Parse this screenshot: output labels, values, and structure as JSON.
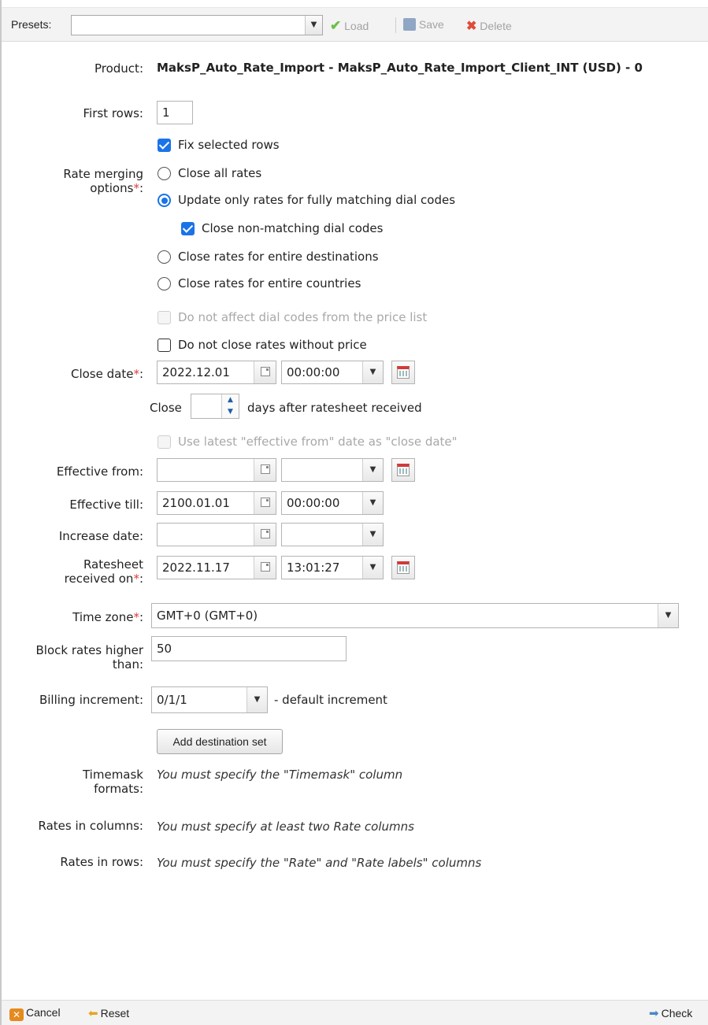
{
  "toolbar": {
    "presets_label": "Presets:",
    "presets_value": "",
    "load_label": "Load",
    "save_label": "Save",
    "delete_label": "Delete"
  },
  "form": {
    "product_label": "Product:",
    "product_value": "MaksP_Auto_Rate_Import - MaksP_Auto_Rate_Import_Client_INT (USD) - 0",
    "first_rows_label": "First rows:",
    "first_rows_value": "1",
    "fix_selected_rows": "Fix selected rows",
    "rate_merging_label_1": "Rate merging",
    "rate_merging_label_2": "options",
    "rate_merging_options": [
      "Close all rates",
      "Update only rates for fully matching dial codes",
      "Close rates for entire destinations",
      "Close rates for entire countries"
    ],
    "rate_merging_selected": 1,
    "close_non_matching": "Close non-matching dial codes",
    "do_not_affect": "Do not affect dial codes from the price list",
    "do_not_close": "Do not close rates without price",
    "close_date_label": "Close date",
    "close_date_value": "2022.12.01",
    "close_time_value": "00:00:00",
    "close_prefix": "Close",
    "close_days_value": "",
    "close_suffix": "days after ratesheet received",
    "use_latest": "Use latest \"effective from\" date as \"close date\"",
    "effective_from_label": "Effective from:",
    "effective_from_date": "",
    "effective_from_time": "",
    "effective_till_label": "Effective till:",
    "effective_till_date": "2100.01.01",
    "effective_till_time": "00:00:00",
    "increase_date_label": "Increase date:",
    "increase_date_date": "",
    "increase_date_time": "",
    "ratesheet_label_1": "Ratesheet",
    "ratesheet_label_2": "received on",
    "ratesheet_date": "2022.11.17",
    "ratesheet_time": "13:01:27",
    "time_zone_label": "Time zone",
    "time_zone_value": "GMT+0 (GMT+0)",
    "block_label_1": "Block rates higher",
    "block_label_2": "than:",
    "block_value": "50",
    "billing_label": "Billing increment:",
    "billing_value": "0/1/1",
    "billing_suffix": "- default increment",
    "add_destination_set": "Add destination set",
    "timemask_label_1": "Timemask",
    "timemask_label_2": "formats:",
    "timemask_hint": "You must specify the \"Timemask\" column",
    "rates_columns_label": "Rates in columns:",
    "rates_columns_hint": "You must specify at least two Rate columns",
    "rates_rows_label": "Rates in rows:",
    "rates_rows_hint": "You must specify the \"Rate\" and \"Rate labels\" columns"
  },
  "footer": {
    "cancel_label": "Cancel",
    "reset_label": "Reset",
    "check_label": "Check"
  },
  "colors": {
    "accent": "#1a73e8",
    "required": "#e23b3b",
    "cancel_icon": "#e68a1e"
  }
}
